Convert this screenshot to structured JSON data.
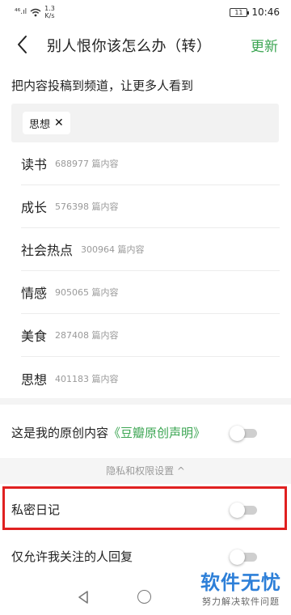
{
  "status_bar": {
    "signal": "⁴⁶.ıl",
    "speed_value": "1.3",
    "speed_unit": "K/s",
    "battery": "11",
    "time": "10:46"
  },
  "header": {
    "title": "别人恨你该怎么办（转）",
    "update_label": "更新"
  },
  "channel_hint": "把内容投稿到频道，让更多人看到",
  "selected_chip": {
    "label": "思想",
    "remove_glyph": "✕"
  },
  "channels": [
    {
      "name": "读书",
      "count": "688977 篇内容"
    },
    {
      "name": "成长",
      "count": "576398 篇内容"
    },
    {
      "name": "社会热点",
      "count": "300964 篇内容"
    },
    {
      "name": "情感",
      "count": "905065 篇内容"
    },
    {
      "name": "美食",
      "count": "287408 篇内容"
    },
    {
      "name": "思想",
      "count": "401183 篇内容"
    }
  ],
  "original": {
    "label": "这是我的原创内容",
    "link": "《豆瓣原创声明》",
    "enabled": false
  },
  "privacy": {
    "header": "隐私和权限设置 ^",
    "private_diary": {
      "label": "私密日记",
      "enabled": false
    },
    "reply_restrict": {
      "label": "仅允许我关注的人回复",
      "enabled": false
    }
  },
  "watermark": {
    "title": "软件无忧",
    "subtitle": "努力解决软件问题"
  },
  "colors": {
    "accent_green": "#3ba552",
    "highlight_red": "#e02020",
    "watermark_blue": "#2d7fd8"
  },
  "icons": {
    "back": "back-chevron-icon",
    "wifi": "wifi-icon",
    "nav_back": "triangle-back-icon",
    "nav_home": "circle-home-icon"
  }
}
